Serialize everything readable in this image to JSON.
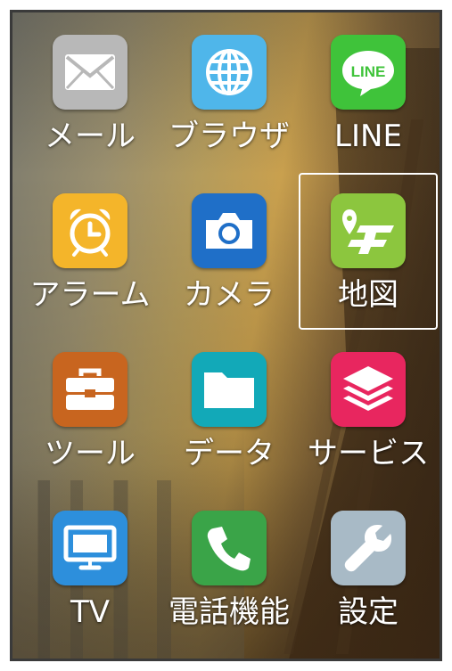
{
  "apps": [
    {
      "label": "メール",
      "icon": "mail-icon",
      "color": "#b8b8b8"
    },
    {
      "label": "ブラウザ",
      "icon": "globe-icon",
      "color": "#4fb6ea"
    },
    {
      "label": "LINE",
      "icon": "line-icon",
      "color": "#3fc33a"
    },
    {
      "label": "アラーム",
      "icon": "alarm-clock-icon",
      "color": "#f4b52a"
    },
    {
      "label": "カメラ",
      "icon": "camera-icon",
      "color": "#1f6fc8"
    },
    {
      "label": "地図",
      "icon": "map-icon",
      "color": "#8cc63e",
      "selected": true
    },
    {
      "label": "ツール",
      "icon": "toolbox-icon",
      "color": "#c8651f"
    },
    {
      "label": "データ",
      "icon": "folder-icon",
      "color": "#12a9b8"
    },
    {
      "label": "サービス",
      "icon": "layers-icon",
      "color": "#e8265f"
    },
    {
      "label": "TV",
      "icon": "tv-icon",
      "color": "#2d8fdc"
    },
    {
      "label": "電話機能",
      "icon": "phone-icon",
      "color": "#3aa448"
    },
    {
      "label": "設定",
      "icon": "wrench-icon",
      "color": "#a8bac6"
    }
  ],
  "line_icon_text": "LINE"
}
